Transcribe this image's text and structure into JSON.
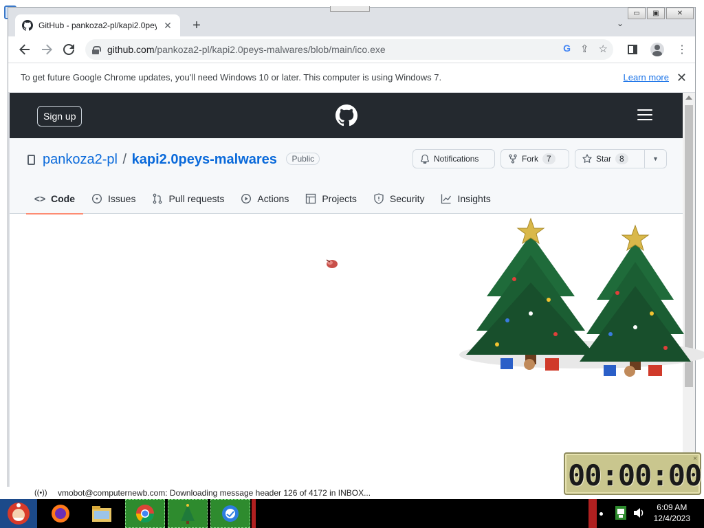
{
  "browser": {
    "tab_title": "GitHub - pankoza2-pl/kapi2.0peys-malwares",
    "url_host": "github.com",
    "url_path": "/pankoza2-pl/kapi2.0peys-malwares/blob/main/ico.exe",
    "window_controls": {
      "minimize": "▭",
      "restore": "▣",
      "close": "✕"
    },
    "new_tab": "+",
    "tab_close": "✕",
    "tab_search": "⌄"
  },
  "infobar": {
    "message": "To get future Google Chrome updates, you'll need Windows 10 or later. This computer is using Windows 7.",
    "learn_more": "Learn more",
    "close": "✕"
  },
  "github": {
    "signup_label": "Sign up",
    "owner": "pankoza2-pl",
    "separator": "/",
    "repo_name": "kapi2.0peys-malwares",
    "visibility": "Public",
    "notifications_label": "Notifications",
    "fork_label": "Fork",
    "fork_count": "7",
    "star_label": "Star",
    "star_count": "8",
    "nav": [
      {
        "label": "Code",
        "active": true
      },
      {
        "label": "Issues"
      },
      {
        "label": "Pull requests"
      },
      {
        "label": "Actions"
      },
      {
        "label": "Projects"
      },
      {
        "label": "Security"
      },
      {
        "label": "Insights"
      }
    ]
  },
  "status_bar": {
    "signal": "((•))",
    "message": "vmobot@computernewb.com: Downloading message header 126 of 4172 in INBOX..."
  },
  "timer": {
    "display": "00:00:00"
  },
  "taskbar": {
    "time": "6:09 AM",
    "date": "12/4/2023"
  },
  "colors": {
    "github_header": "#24292f",
    "link_blue": "#0969da",
    "active_tab_underline": "#fd8c73",
    "chrome_frame": "#dee1e6",
    "taskbar": "#000000"
  }
}
